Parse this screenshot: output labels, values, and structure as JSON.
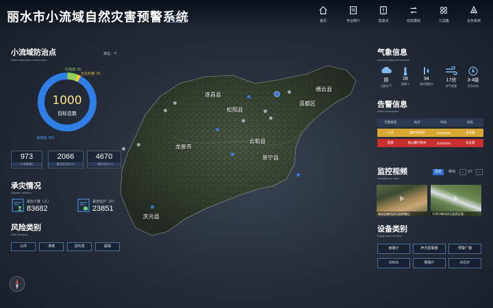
{
  "header": {
    "title": "丽水市小流域自然灾害预警系统",
    "region": "丽水市",
    "nav": [
      {
        "icon": "home-icon",
        "label": "首页"
      },
      {
        "icon": "platform-icon",
        "label": "平台简介"
      },
      {
        "icon": "hazard-point-icon",
        "label": "隐患点"
      },
      {
        "icon": "dynamic-model-icon",
        "label": "动态模拟"
      },
      {
        "icon": "toolbox-icon",
        "label": "工具箱"
      },
      {
        "icon": "business-system-icon",
        "label": "业务系统"
      }
    ]
  },
  "left": {
    "prevention": {
      "title": "小流域防治点",
      "subtitle": "Small watershed control point",
      "unit": "单位：个",
      "total": "1000",
      "total_label": "目标总数",
      "legend_done": "已完成: 55",
      "legend_progress": "正在实施: 22",
      "legend_pending": "待完成: 923",
      "ring": {
        "done": 55,
        "progress": 22,
        "pending": 923
      }
    },
    "stats": [
      {
        "value": "973",
        "label": "小流域(条)"
      },
      {
        "value": "2066",
        "label": "重点防治村(个)"
      },
      {
        "value": "4670",
        "label": "一般防治村(个)"
      }
    ],
    "disaster": {
      "title": "承灾情况",
      "subtitle": "Disaster situation",
      "people_label": "承灾人数（人）",
      "people_value": "83682",
      "households_label": "承灾住户（户）",
      "households_value": "23851"
    },
    "risk": {
      "title": "风险类别",
      "subtitle": "Risk category",
      "items": [
        "山洪",
        "滑坡",
        "泥石流",
        "崩塌"
      ]
    }
  },
  "map": {
    "labels": [
      "遂昌县",
      "松阳县",
      "缙云县",
      "莲都区",
      "龙泉市",
      "云和县",
      "景宁县",
      "庆元县"
    ]
  },
  "right": {
    "weather": {
      "title": "气象信息",
      "subtitle": "Meteorological information",
      "items": [
        {
          "icon": "cloud-rain-icon",
          "value": "阴",
          "label": "当前天气"
        },
        {
          "icon": "thermometer-icon",
          "value": "28",
          "label": "温度°C"
        },
        {
          "icon": "humidity-icon",
          "value": "94",
          "label": "相对湿度%"
        },
        {
          "icon": "air-quality-icon",
          "value": "17优",
          "label": "空气质量"
        },
        {
          "icon": "wind-icon",
          "value": "3-4级",
          "label": "风力风向"
        }
      ]
    },
    "alarm": {
      "title": "告警信息",
      "subtitle": "Alarm information",
      "headers": [
        "告警类型",
        "地点",
        "时间",
        "状态"
      ],
      "rows": [
        {
          "type": "火灾",
          "place": "福岭县陈村",
          "time": "2020/8/30",
          "status": "未处置"
        },
        {
          "type": "雨量",
          "place": "黄山麓行政村",
          "time": "2020/8/29",
          "status": "未处置"
        }
      ]
    },
    "video": {
      "title": "监控视频",
      "subtitle": "Surveillance video",
      "tab_fixed": "固定",
      "tab_mobile": "移动",
      "page": "1/7",
      "feeds": [
        "城北区域村(庆元县崩塌区)",
        "大洋行政村(庆元县泥石流)"
      ]
    },
    "devices": {
      "title": "设备类别",
      "subtitle": "Equipment condition",
      "items": [
        "雨量计",
        "声光报警器",
        "预警广播",
        "GNSS",
        "裂缝计",
        "水位计"
      ]
    }
  }
}
